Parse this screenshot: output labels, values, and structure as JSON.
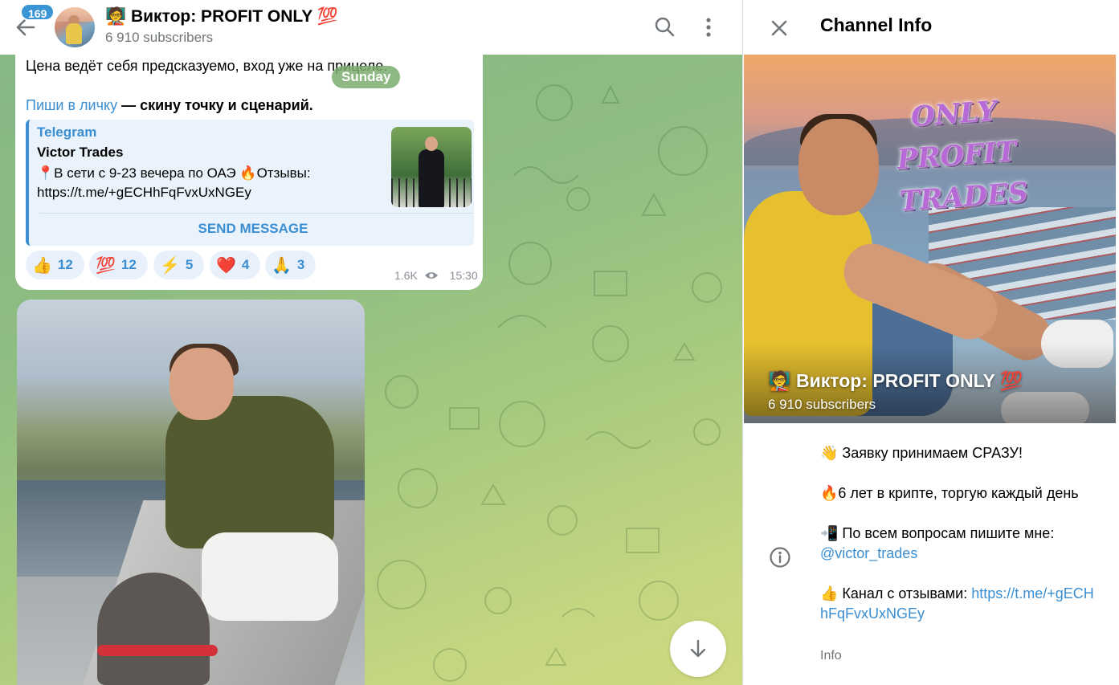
{
  "header": {
    "unread_badge": "169",
    "channel_title": "🧑‍🏫 Виктор: PROFIT ONLY 💯",
    "subscribers": "6 910 subscribers"
  },
  "message": {
    "line1": "Цена ведёт себя предсказуемо, вход уже на прицеле.",
    "date_pill": "Sunday",
    "link_text": "Пиши в личку",
    "line2_rest": " — скину точку и сценарий.",
    "preview": {
      "site": "Telegram",
      "title": "Victor Trades",
      "description": "📍В сети с 9-23 вечера по ОАЭ 🔥Отзывы: https://t.me/+gECHhFqFvxUxNGEy",
      "button": "SEND MESSAGE"
    },
    "reactions": [
      {
        "emoji": "👍",
        "count": "12"
      },
      {
        "emoji": "💯",
        "count": "12"
      },
      {
        "emoji": "⚡",
        "count": "5"
      },
      {
        "emoji": "❤️",
        "count": "4"
      },
      {
        "emoji": "🙏",
        "count": "3"
      }
    ],
    "views": "1.6K",
    "time": "15:30"
  },
  "info_panel": {
    "heading": "Channel Info",
    "cover_title": "🧑‍🏫 Виктор: PROFIT ONLY 💯",
    "cover_subscribers": "6 910 subscribers",
    "cover_logo": "ONLY PROFIT TRADES",
    "about": {
      "line1": "👋 Заявку принимаем СРАЗУ!",
      "line2": "🔥6 лет в крипте, торгую каждый день",
      "line3_text": "📲 По всем вопросам пишите мне:",
      "line3_link": "@victor_trades",
      "line4_text": "👍 Канал с отзывами: ",
      "line4_link": "https://t.me/+gECHhFqFvxUxNGEy"
    },
    "label": "Info"
  },
  "icons": [
    "back-arrow-icon",
    "search-icon",
    "more-vertical-icon",
    "close-icon",
    "info-icon",
    "eye-icon",
    "arrow-down-icon"
  ]
}
